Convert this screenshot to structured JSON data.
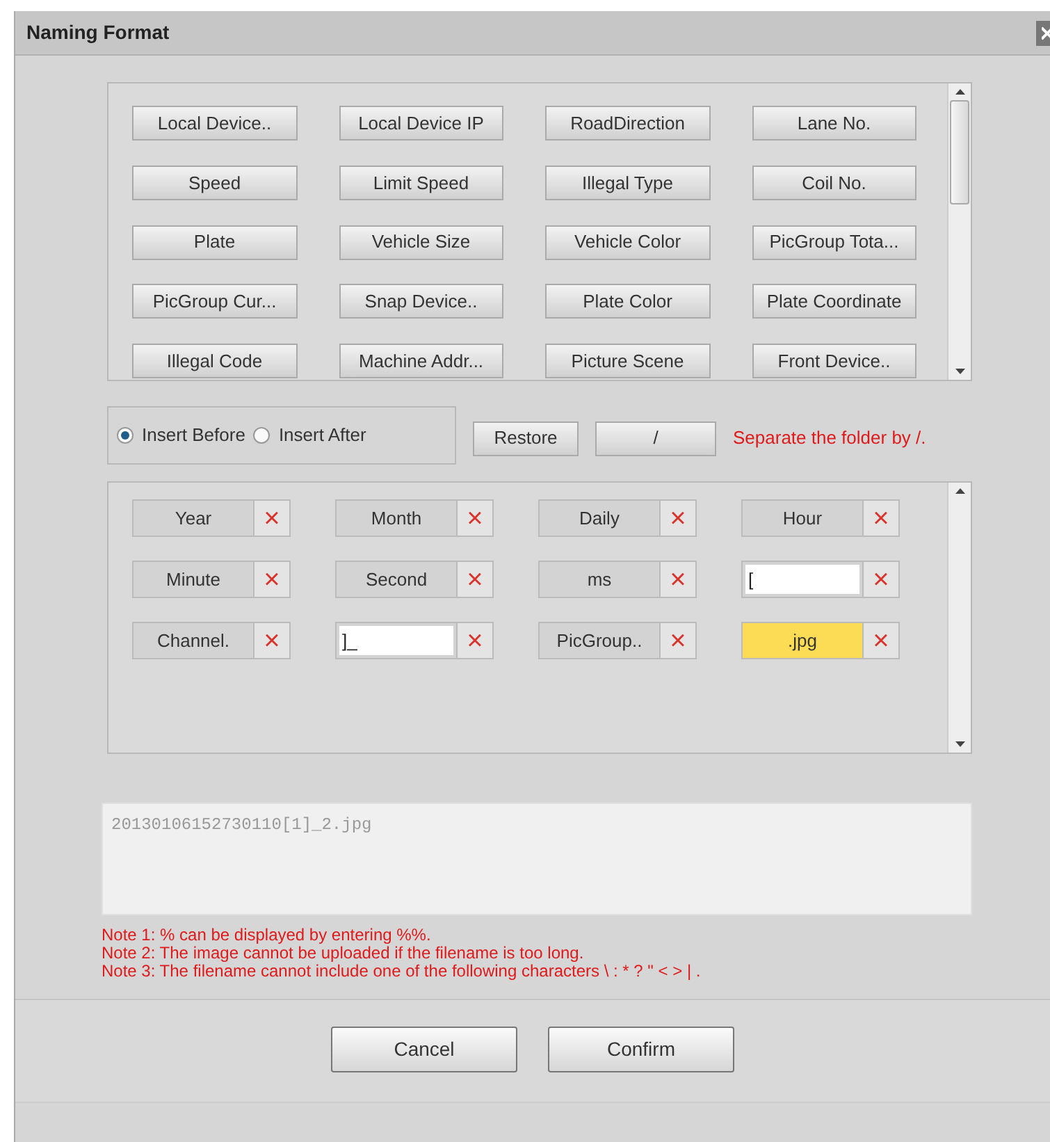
{
  "window": {
    "title": "Naming Format"
  },
  "field_buttons": [
    "Local Device..",
    "Local Device IP",
    "RoadDirection",
    "Lane No.",
    "Speed",
    "Limit Speed",
    "Illegal Type",
    "Coil No.",
    "Plate",
    "Vehicle Size",
    "Vehicle Color",
    "PicGroup Tota...",
    "PicGroup Cur...",
    "Snap Device..",
    "Plate Color",
    "Plate Coordinate",
    "Illegal Code",
    "Machine Addr...",
    "Picture Scene",
    "Front Device.."
  ],
  "insert_position": [
    {
      "label": "Insert Before",
      "selected": true
    },
    {
      "label": "Insert After",
      "selected": false
    }
  ],
  "restore_button": "Restore",
  "separator_button": "/",
  "separator_hint": "Separate the folder by /.",
  "format_items": [
    {
      "kind": "label",
      "text": "Year",
      "selected": false
    },
    {
      "kind": "label",
      "text": "Month",
      "selected": false
    },
    {
      "kind": "label",
      "text": "Daily",
      "selected": false
    },
    {
      "kind": "label",
      "text": "Hour",
      "selected": false
    },
    {
      "kind": "label",
      "text": "Minute",
      "selected": false
    },
    {
      "kind": "label",
      "text": "Second",
      "selected": false
    },
    {
      "kind": "label",
      "text": "ms",
      "selected": false
    },
    {
      "kind": "input",
      "text": "[",
      "selected": false
    },
    {
      "kind": "label",
      "text": "Channel.",
      "selected": false
    },
    {
      "kind": "input",
      "text": "]_",
      "selected": false
    },
    {
      "kind": "label",
      "text": "PicGroup..",
      "selected": false
    },
    {
      "kind": "label",
      "text": ".jpg",
      "selected": true
    }
  ],
  "remove_icon": "×",
  "preview": "20130106152730110[1]_2.jpg",
  "notes": [
    "Note 1: % can be displayed by entering %%.",
    "Note 2: The image cannot be uploaded if the filename is too long.",
    "Note 3: The filename cannot include one of the following characters \\ : * ? \" < > | ."
  ],
  "buttons": [
    "Cancel",
    "Confirm"
  ]
}
